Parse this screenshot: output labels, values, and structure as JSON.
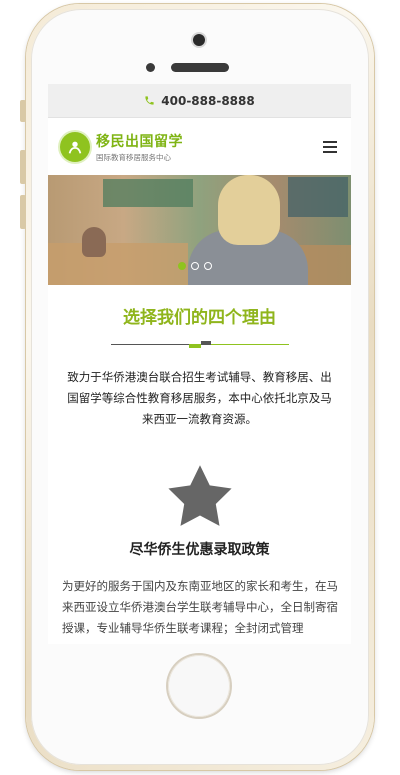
{
  "topbar": {
    "phone": "400-888-8888",
    "icon": "phone-icon"
  },
  "header": {
    "logo_title": "移民出国留学",
    "logo_subtitle": "国际教育移居服务中心",
    "menu_icon": "hamburger-menu-icon"
  },
  "banner": {
    "slides": 3,
    "active_slide": 1
  },
  "section": {
    "title": "选择我们的四个理由",
    "intro": "致力于华侨港澳台联合招生考试辅导、教育移居、出国留学等综合性教育移居服务，本中心依托北京及马来西亚一流教育资源。"
  },
  "feature": {
    "icon": "star-icon",
    "title": "尽华侨生优惠录取政策",
    "text": "为更好的服务于国内及东南亚地区的家长和考生，在马来西亚设立华侨港澳台学生联考辅导中心，全日制寄宿授课，专业辅导华侨生联考课程；全封闭式管理"
  },
  "colors": {
    "accent": "#8fc31f",
    "star": "#666666"
  }
}
